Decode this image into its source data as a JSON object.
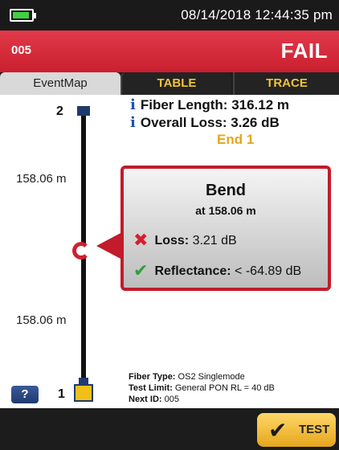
{
  "status_bar": {
    "datetime": "08/14/2018 12:44:35 pm",
    "battery_icon": "battery-icon",
    "battery_color": "#3fd13f"
  },
  "header": {
    "id": "005",
    "result": "FAIL",
    "color": "#d0202f"
  },
  "tabs": [
    {
      "label": "EventMap",
      "active": true
    },
    {
      "label": "TABLE",
      "active": false
    },
    {
      "label": "TRACE",
      "active": false
    }
  ],
  "summary": {
    "fiber_length_label": "Fiber Length:",
    "fiber_length_value": "316.12 m",
    "overall_loss_label": "Overall Loss:",
    "overall_loss_value": "3.26 dB",
    "end_label": "End 1"
  },
  "event_map": {
    "top_node": "2",
    "bottom_node": "1",
    "upper_distance": "158.06 m",
    "lower_distance": "158.06 m"
  },
  "event": {
    "title": "Bend",
    "location": "at 158.06 m",
    "loss_label": "Loss:",
    "loss_value": "3.21 dB",
    "loss_status_icon": "x-icon",
    "reflectance_label": "Reflectance:",
    "reflectance_value": "< -64.89 dB",
    "reflectance_status_icon": "check-icon"
  },
  "details": {
    "fiber_type_label": "Fiber Type:",
    "fiber_type_value": "OS2 Singlemode",
    "test_limit_label": "Test Limit:",
    "test_limit_value": "General PON RL = 40 dB",
    "next_id_label": "Next ID:",
    "next_id_value": "005"
  },
  "help_button": {
    "label": "?"
  },
  "test_button": {
    "label": "TEST"
  }
}
